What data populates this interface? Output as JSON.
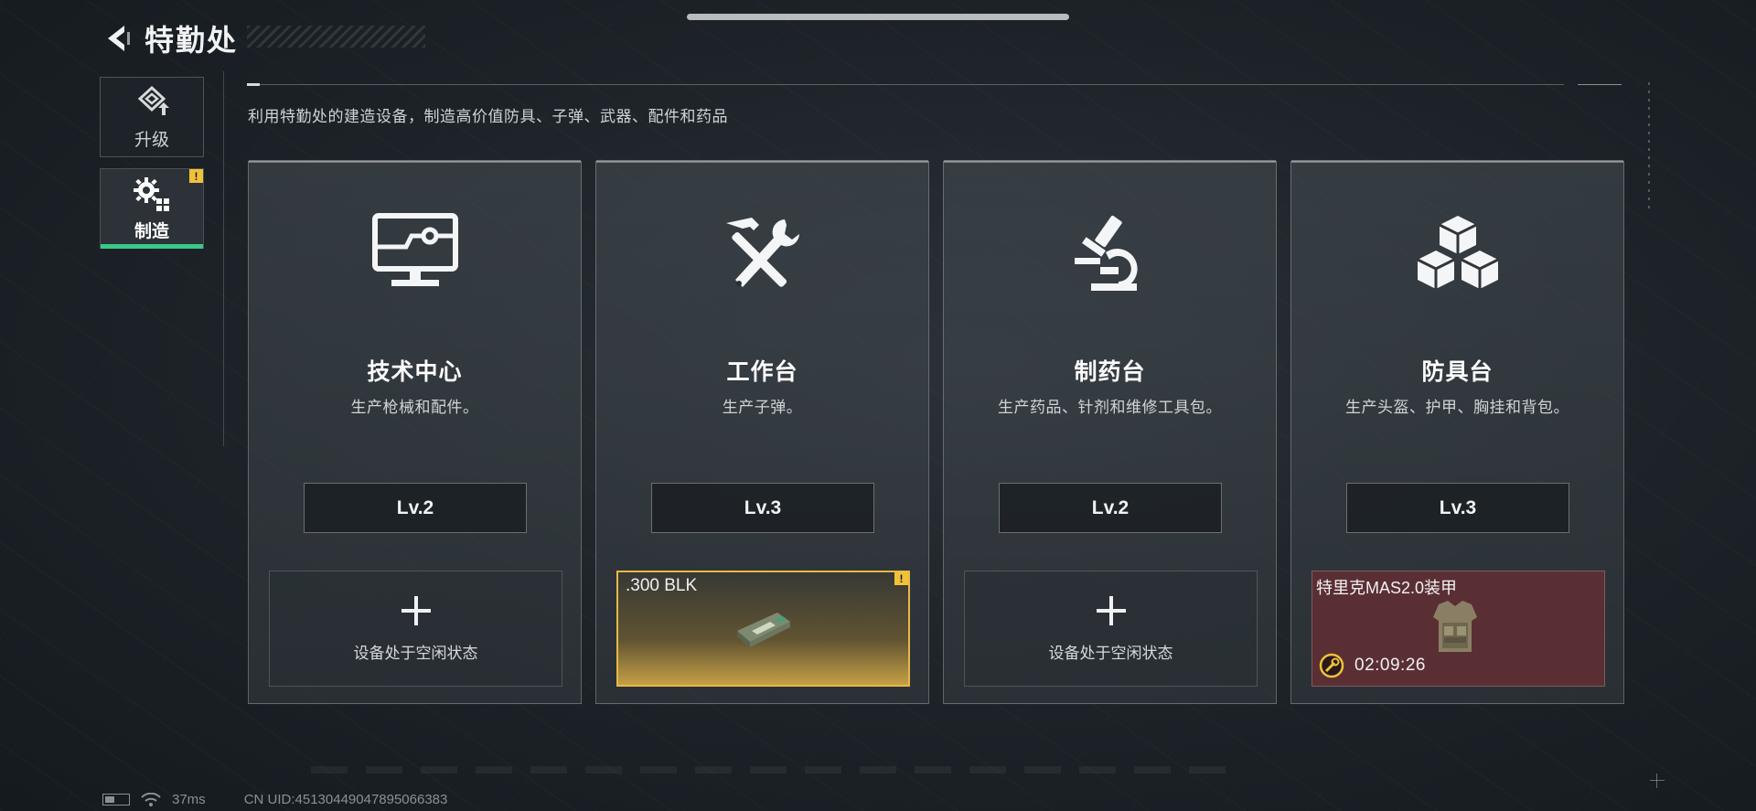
{
  "header": {
    "title": "特勤处"
  },
  "sidebar": {
    "tabs": [
      {
        "label": "升级",
        "icon": "upgrade-icon",
        "active": false
      },
      {
        "label": "制造",
        "icon": "gears-icon",
        "active": true,
        "alert": "!"
      }
    ]
  },
  "main": {
    "subtitle": "利用特勤处的建造设备，制造高价值防具、子弹、武器、配件和药品",
    "stations": [
      {
        "name": "技术中心",
        "description": "生产枪械和配件。",
        "level": "Lv.2",
        "icon": "monitor-circuit-icon",
        "slot": {
          "state": "idle",
          "label": "设备处于空闲状态",
          "icon": "plus-icon"
        }
      },
      {
        "name": "工作台",
        "description": "生产子弹。",
        "level": "Lv.3",
        "icon": "hammer-wrench-icon",
        "slot": {
          "state": "done",
          "item_name": ".300 BLK",
          "alert": "!",
          "item_icon": "ammo-box-icon"
        }
      },
      {
        "name": "制药台",
        "description": "生产药品、针剂和维修工具包。",
        "level": "Lv.2",
        "icon": "microscope-icon",
        "slot": {
          "state": "idle",
          "label": "设备处于空闲状态",
          "icon": "plus-icon"
        }
      },
      {
        "name": "防具台",
        "description": "生产头盔、护甲、胸挂和背包。",
        "level": "Lv.3",
        "icon": "cubes-icon",
        "slot": {
          "state": "producing",
          "item_name": "特里克MAS2.0装甲",
          "timer": "02:09:26",
          "item_icon": "body-armor-icon"
        }
      }
    ]
  },
  "footer": {
    "ping": "37ms",
    "uid": "CN UID:45130449047895066383"
  },
  "colors": {
    "accent_green": "#39c98a",
    "alert_yellow": "#f0c23a",
    "done_gold": "#e7b946",
    "producing_red": "#5a2f34"
  }
}
